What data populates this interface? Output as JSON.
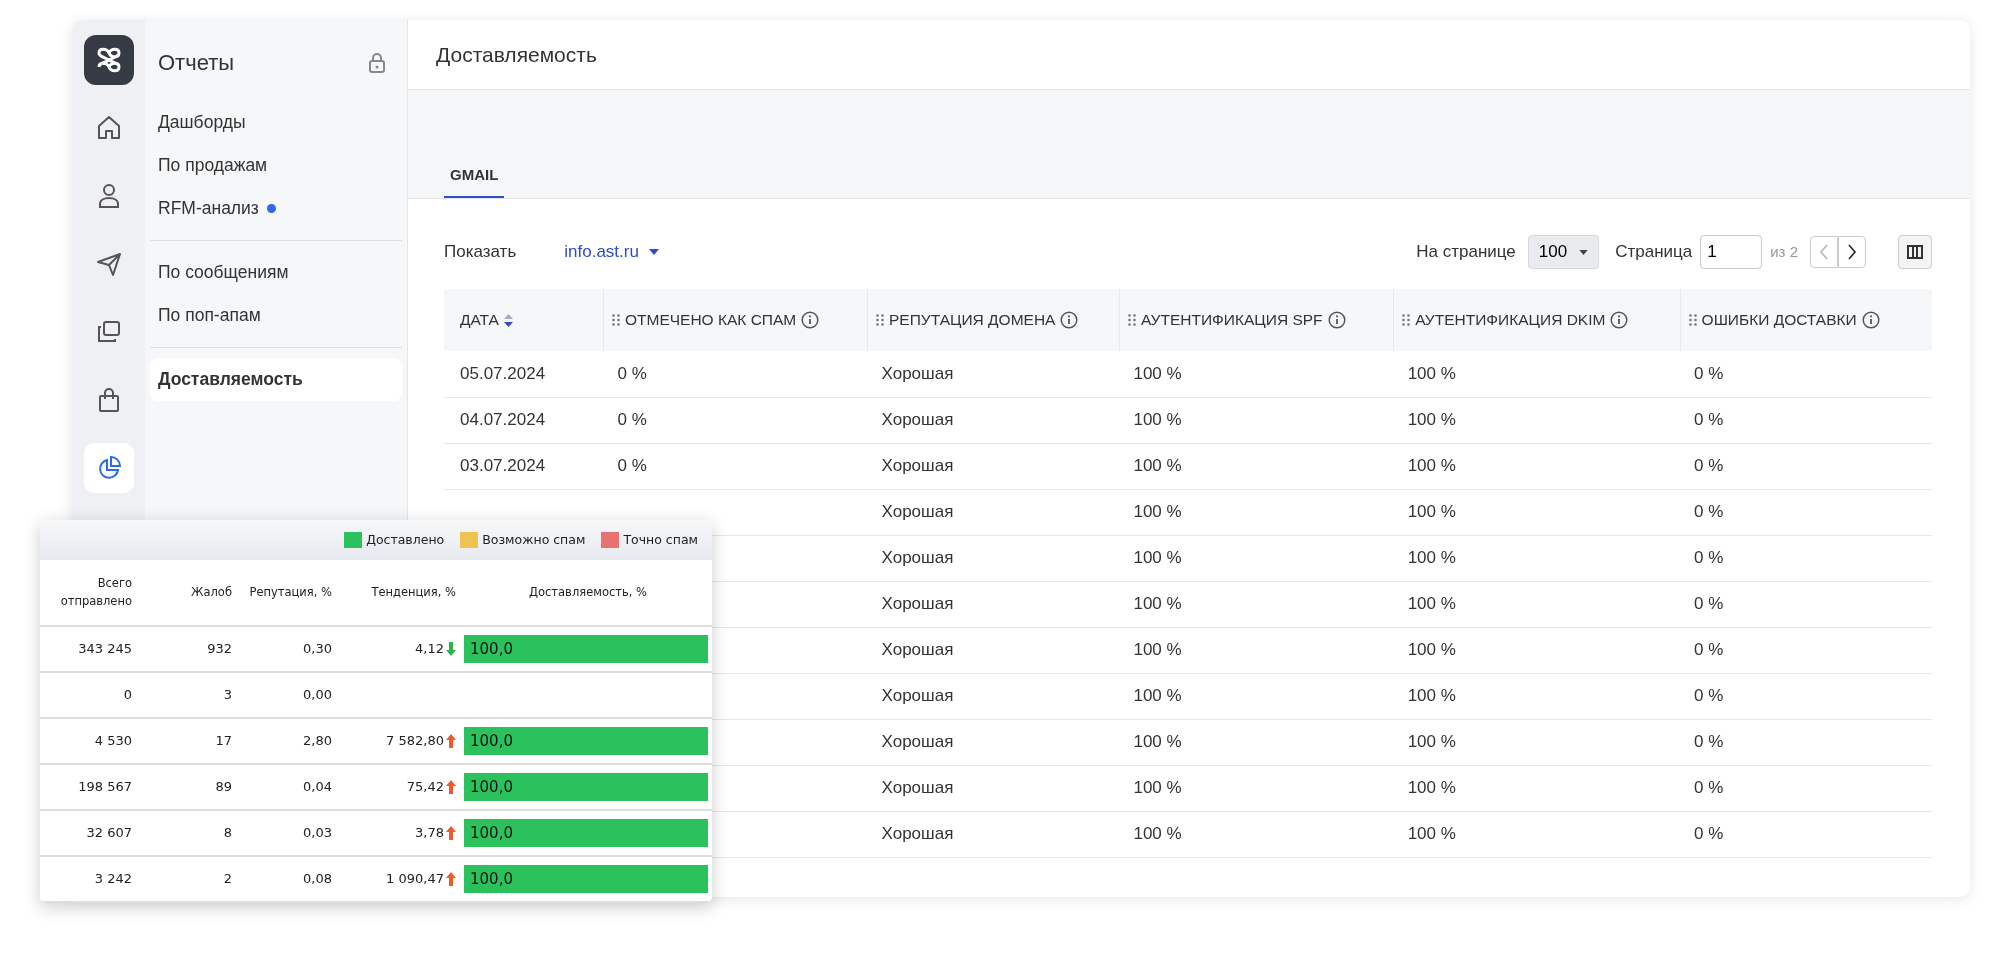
{
  "rail": {
    "items": [
      {
        "kind": "home",
        "selected": false
      },
      {
        "kind": "person",
        "selected": false
      },
      {
        "kind": "send",
        "selected": false
      },
      {
        "kind": "windows",
        "selected": false
      },
      {
        "kind": "bag",
        "selected": false
      },
      {
        "kind": "pie",
        "selected": true
      }
    ]
  },
  "nav": {
    "title": "Отчеты",
    "groups": [
      [
        {
          "label": "Дашборды",
          "selected": false,
          "unread": false
        },
        {
          "label": "По продажам",
          "selected": false,
          "unread": false
        },
        {
          "label": "RFM-анализ",
          "selected": false,
          "unread": true
        }
      ],
      [
        {
          "label": "По сообщениям",
          "selected": false,
          "unread": false
        },
        {
          "label": "По поп-апам",
          "selected": false,
          "unread": false
        }
      ],
      [
        {
          "label": "Доставляемость",
          "selected": true,
          "unread": false
        }
      ]
    ]
  },
  "page": {
    "title": "Доставляемость"
  },
  "tabs": [
    {
      "label": "GMAIL",
      "selected": true
    }
  ],
  "filter": {
    "label": "Показать",
    "value": "info.ast.ru"
  },
  "pager": {
    "per_page_label": "На странице",
    "per_page": "100",
    "page_label": "Страница",
    "page": "1",
    "page_total": "из 2",
    "prev_disabled": true,
    "next_disabled": false
  },
  "table": {
    "columns": [
      {
        "label": "ДАТА",
        "sortable": true,
        "info": false
      },
      {
        "label": "ОТМЕЧЕНО КАК СПАМ",
        "sortable": false,
        "info": true
      },
      {
        "label": "РЕПУТАЦИЯ ДОМЕНА",
        "sortable": false,
        "info": true
      },
      {
        "label": "АУТЕНТИФИКАЦИЯ SPF",
        "sortable": false,
        "info": true
      },
      {
        "label": "АУТЕНТИФИКАЦИЯ DKIM",
        "sortable": false,
        "info": true
      },
      {
        "label": "ОШИБКИ ДОСТАВКИ",
        "sortable": false,
        "info": true
      }
    ],
    "rows": [
      {
        "cells": [
          "05.07.2024",
          "0 %",
          "Хорошая",
          "100 %",
          "100 %",
          "0 %"
        ]
      },
      {
        "cells": [
          "04.07.2024",
          "0 %",
          "Хорошая",
          "100 %",
          "100 %",
          "0 %"
        ]
      },
      {
        "cells": [
          "03.07.2024",
          "0 %",
          "Хорошая",
          "100 %",
          "100 %",
          "0 %"
        ]
      },
      {
        "cells": [
          null,
          null,
          "Хорошая",
          "100 %",
          "100 %",
          "0 %"
        ]
      },
      {
        "cells": [
          null,
          null,
          "Хорошая",
          "100 %",
          "100 %",
          "0 %"
        ]
      },
      {
        "cells": [
          null,
          null,
          "Хорошая",
          "100 %",
          "100 %",
          "0 %"
        ]
      },
      {
        "cells": [
          null,
          null,
          "Хорошая",
          "100 %",
          "100 %",
          "0 %"
        ]
      },
      {
        "cells": [
          null,
          null,
          "Хорошая",
          "100 %",
          "100 %",
          "0 %"
        ]
      },
      {
        "cells": [
          null,
          null,
          "Хорошая",
          "100 %",
          "100 %",
          "0 %"
        ]
      },
      {
        "cells": [
          null,
          null,
          "Хорошая",
          "100 %",
          "100 %",
          "0 %"
        ]
      },
      {
        "cells": [
          null,
          null,
          "Хорошая",
          "100 %",
          "100 %",
          "0 %"
        ]
      }
    ]
  },
  "overlay": {
    "legend": [
      {
        "label": "Доставлено",
        "color": "#2bc15c"
      },
      {
        "label": "Возможно спам",
        "color": "#ecc44f"
      },
      {
        "label": "Точно спам",
        "color": "#e8726f"
      }
    ],
    "columns": [
      "Всего отправлено",
      "Жалоб",
      "Репутация, %",
      "Тенденция, %",
      "Доставляемость, %"
    ],
    "rows": [
      {
        "sent": "343 245",
        "complaints": "932",
        "reputation": "0,30",
        "trend": {
          "value": "4,12",
          "up": false
        },
        "delivery": {
          "label": "100,0",
          "level": 1
        }
      },
      {
        "sent": "0",
        "complaints": "3",
        "reputation": "0,00"
      },
      {
        "sent": "4 530",
        "complaints": "17",
        "reputation": "2,80",
        "trend": {
          "value": "7 582,80",
          "up": true
        },
        "delivery": {
          "label": "100,0",
          "level": 1
        }
      },
      {
        "sent": "198 567",
        "complaints": "89",
        "reputation": "0,04",
        "trend": {
          "value": "75,42",
          "up": true
        },
        "delivery": {
          "label": "100,0",
          "level": 1
        }
      },
      {
        "sent": "32 607",
        "complaints": "8",
        "reputation": "0,03",
        "trend": {
          "value": "3,78",
          "up": true
        },
        "delivery": {
          "label": "100,0",
          "level": 1
        }
      },
      {
        "sent": "3 242",
        "complaints": "2",
        "reputation": "0,08",
        "trend": {
          "value": "1 090,47",
          "up": true
        },
        "delivery": {
          "label": "100,0",
          "level": 1
        }
      }
    ]
  }
}
